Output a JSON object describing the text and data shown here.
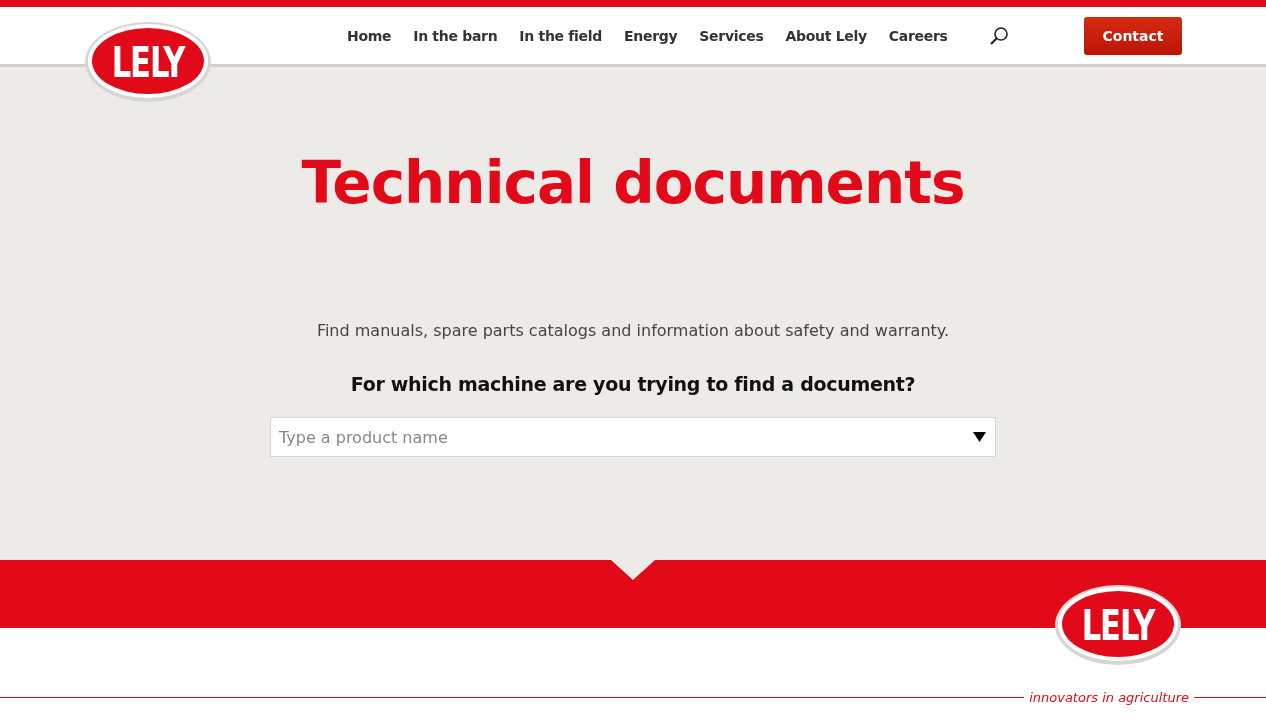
{
  "header": {
    "logo": "LELY",
    "nav": [
      {
        "label": "Home"
      },
      {
        "label": "In the barn"
      },
      {
        "label": "In the field"
      },
      {
        "label": "Energy"
      },
      {
        "label": "Services"
      },
      {
        "label": "About Lely"
      },
      {
        "label": "Careers"
      }
    ],
    "contact_button": "Contact"
  },
  "hero": {
    "title": "Technical documents",
    "intro": "Find manuals, spare parts catalogs and information about safety and warranty.",
    "question": "For which machine are you trying to find a document?",
    "product_select": {
      "placeholder": "Type a product name"
    }
  },
  "footer": {
    "logo": "LELY",
    "tagline": "innovators in agriculture"
  }
}
